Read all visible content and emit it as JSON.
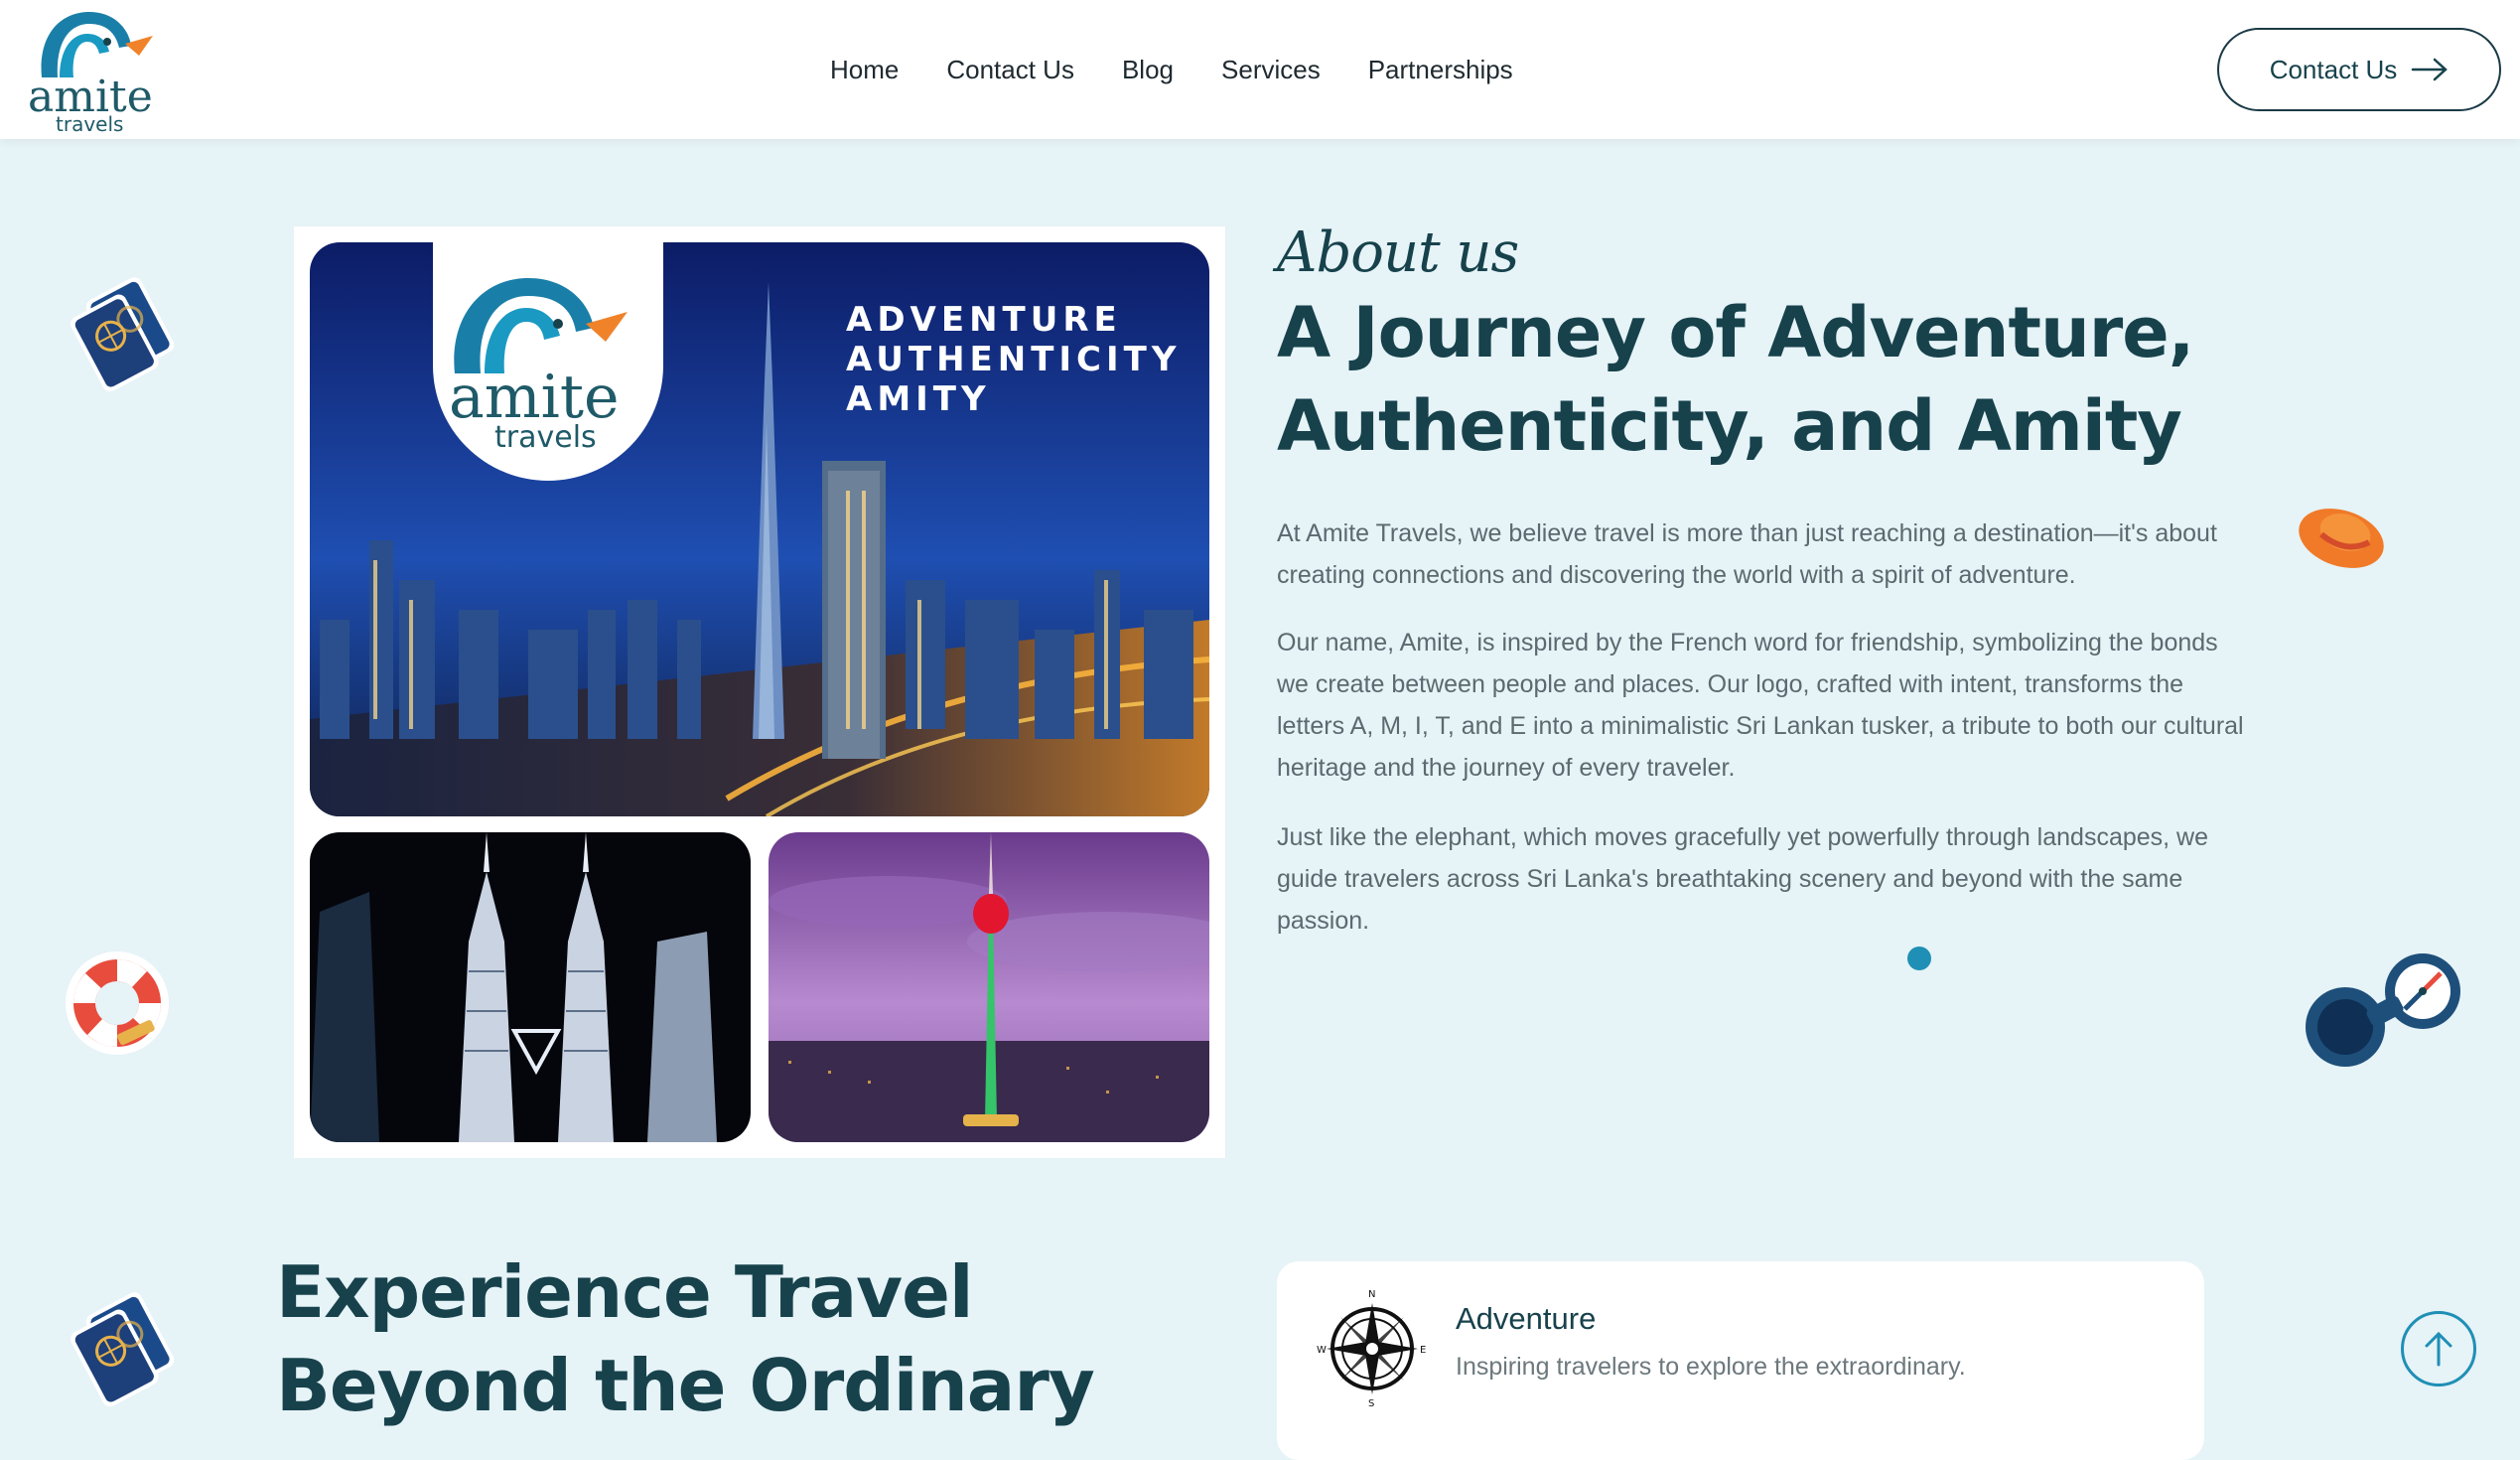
{
  "header": {
    "logo": {
      "word": "amite",
      "sub": "travels"
    },
    "nav": [
      "Home",
      "Contact Us",
      "Blog",
      "Services",
      "Partnerships"
    ],
    "cta_label": "Contact Us"
  },
  "collage": {
    "badge": {
      "word": "amite",
      "sub": "travels"
    },
    "tagline": [
      "ADVENTURE",
      "AUTHENTICITY",
      "AMITY"
    ]
  },
  "about": {
    "eyebrow": "About us",
    "title": "A Journey of Adventure, Authenticity, and Amity",
    "paragraphs": [
      "At Amite Travels, we believe travel is more than just reaching a destination—it's about creating connections and discovering the world with a spirit of adventure.",
      "Our name, Amite, is inspired by the French word for friendship, symbolizing the bonds we create between people and places. Our logo, crafted with intent, transforms the letters A, M, I, T, and E into a minimalistic Sri Lankan tusker, a tribute to both our cultural heritage and the journey of every traveler.",
      "Just like the elephant, which moves gracefully yet powerfully through landscapes, we guide travelers across Sri Lanka's breathtaking scenery and beyond with the same passion."
    ]
  },
  "experience": {
    "title": "Experience Travel Beyond the Ordinary",
    "card": {
      "title": "Adventure",
      "description": "Inspiring travelers to explore the extraordinary.",
      "compass_letters": [
        "N",
        "E",
        "S",
        "W"
      ]
    }
  },
  "colors": {
    "primary": "#17424c",
    "accent": "#1f8fb5",
    "logo_orange": "#f0832a",
    "background": "#e6f3f7"
  },
  "icons": [
    "passport-icon",
    "lifebuoy-icon",
    "hat-icon",
    "binoculars-icon",
    "compass-icon",
    "arrow-right-icon",
    "arrow-up-icon"
  ]
}
